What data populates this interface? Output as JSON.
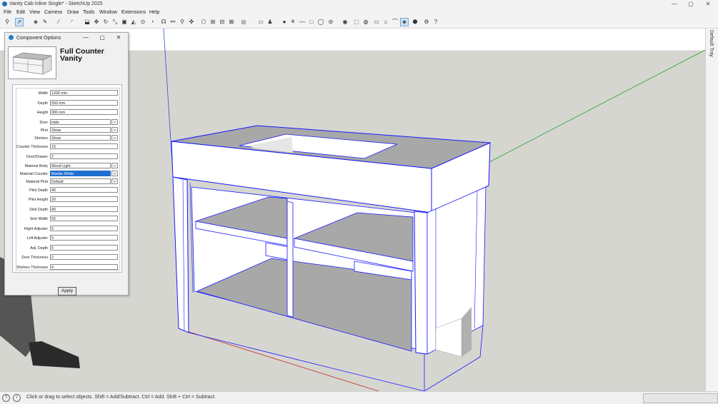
{
  "window": {
    "title": "Vanity Cab Inline Single* - SketchUp 2025",
    "controls": [
      "—",
      "▢",
      "✕"
    ]
  },
  "menu": [
    "File",
    "Edit",
    "View",
    "Camera",
    "Draw",
    "Tools",
    "Window",
    "Extensions",
    "Help"
  ],
  "tray_label": "Default Tray",
  "status": {
    "message": "Click or drag to select objects. Shift = Add/Subtract. Ctrl = Add. Shift + Ctrl = Subtract."
  },
  "dialog": {
    "title": "Component Options",
    "component_name": "Full Counter Vanity",
    "apply_label": "Apply",
    "fields": [
      {
        "label": "Width",
        "value": "1200 mm",
        "type": "text"
      },
      {
        "label": "Depth",
        "value": "550 mm",
        "type": "text"
      },
      {
        "label": "Height",
        "value": "900 mm",
        "type": "text"
      },
      {
        "label": "Door",
        "value": "Hide",
        "type": "select"
      },
      {
        "label": "Plint",
        "value": "Show",
        "type": "select"
      },
      {
        "label": "Shelves",
        "value": "Show",
        "type": "select"
      },
      {
        "label": "Counter Thickness",
        "value": "15",
        "type": "text"
      },
      {
        "label": "Door/Drawer",
        "value": "2",
        "type": "text"
      },
      {
        "label": "Material Body",
        "value": "Wood Light",
        "type": "select"
      },
      {
        "label": "Material Counter",
        "value": "Marble White",
        "type": "select",
        "highlighted": true
      },
      {
        "label": "Material Plint",
        "value": "Default",
        "type": "select"
      },
      {
        "label": "Plint Depth",
        "value": "40",
        "type": "text"
      },
      {
        "label": "Plint Height",
        "value": "20",
        "type": "text"
      },
      {
        "label": "Sink Depth",
        "value": "40",
        "type": "text"
      },
      {
        "label": "Sink Width",
        "value": "55",
        "type": "text"
      },
      {
        "label": "Right Adjuster",
        "value": "5",
        "type": "text"
      },
      {
        "label": "Left Adjuster",
        "value": "5",
        "type": "text"
      },
      {
        "label": "Adj. Depth",
        "value": "5",
        "type": "text"
      },
      {
        "label": "Door Thickness",
        "value": "2",
        "type": "text"
      },
      {
        "label": "Shelves Thickness",
        "value": "4",
        "type": "text"
      }
    ]
  },
  "toolbar_icons": [
    "zoom-icon",
    "select-icon",
    "eraser-icon",
    "pencil-icon",
    "line-icon",
    "arc-icon",
    "push-pull-icon",
    "move-icon",
    "rotate-icon",
    "scale-icon",
    "offset-icon",
    "follow-me-icon",
    "tape-icon",
    "protractor-icon",
    "text-icon",
    "dimension-icon",
    "axes-icon",
    "section-icon",
    "orbit-icon",
    "pan-icon",
    "zoom-extents-icon",
    "iso-view-icon",
    "top-view-icon",
    "front-view-icon",
    "right-view-icon",
    "back-view-icon",
    "left-view-icon",
    "layers-icon",
    "styles-icon",
    "paint-icon",
    "shadow-icon",
    "fog-icon",
    "component-icon",
    "outliner-icon",
    "hidden-icon",
    "xray-icon",
    "wireframe-icon",
    "shaded-icon",
    "textured-icon",
    "mono-icon",
    "extension-icon",
    "help-icon"
  ],
  "colors": {
    "selection_edge": "#1a1aff",
    "green_axis": "#2aa02a",
    "red_axis": "#c03020",
    "blue_axis": "#3050d0",
    "highlight": "#1f6fd0"
  }
}
